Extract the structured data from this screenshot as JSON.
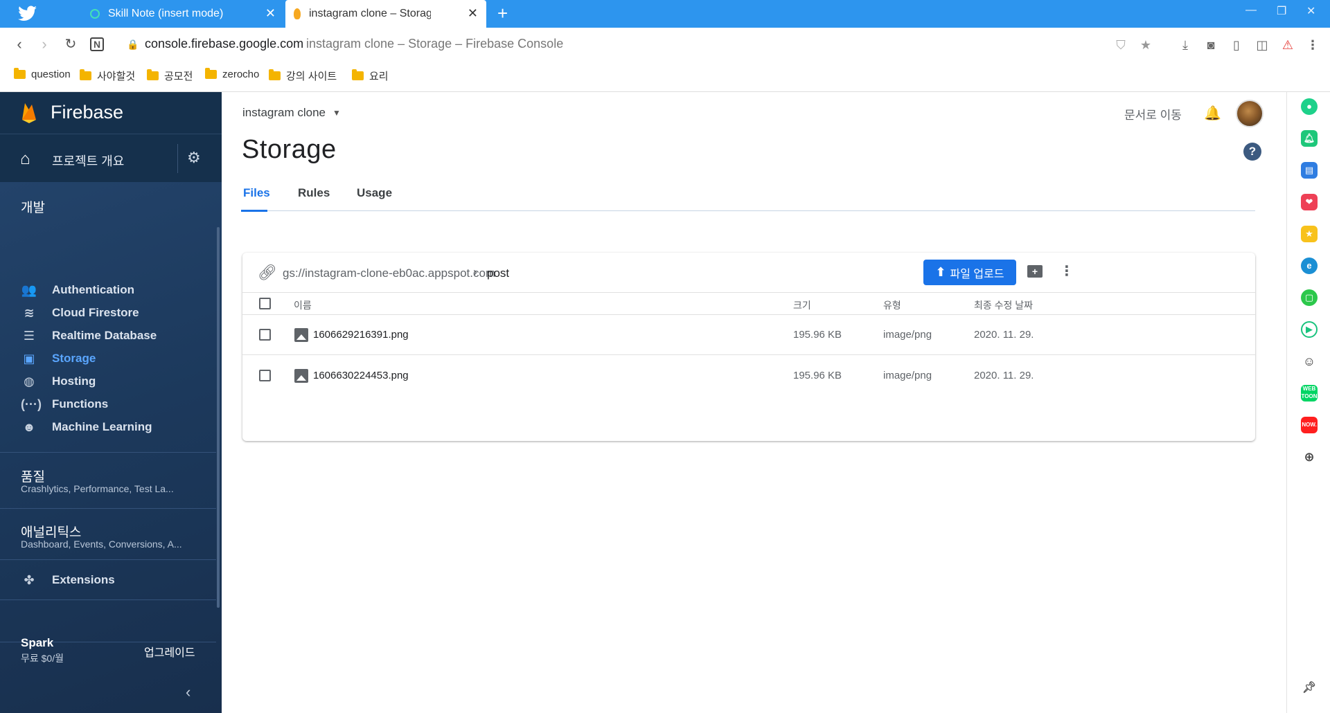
{
  "browser": {
    "tabs": [
      {
        "title": "Skill Note (insert mode)",
        "close": "✕"
      },
      {
        "title": "instagram clone – Storage – Fir",
        "close": "✕"
      }
    ],
    "new_tab": "+",
    "window_controls": {
      "minimize": "—",
      "restore": "❐",
      "close": "✕"
    },
    "address": {
      "host": "console.firebase.google.com",
      "page_title": "instagram clone – Storage – Firebase Console"
    },
    "bookmarks": [
      "question",
      "사야할것",
      "공모전",
      "zerocho",
      "강의 사이트",
      "요리"
    ]
  },
  "sidebar": {
    "brand": "Firebase",
    "overview_label": "프로젝트 개요",
    "develop_title": "개발",
    "develop_items": [
      {
        "label": "Authentication",
        "icon": "people-icon",
        "active": false
      },
      {
        "label": "Cloud Firestore",
        "icon": "firestore-icon",
        "active": false
      },
      {
        "label": "Realtime Database",
        "icon": "database-icon",
        "active": false
      },
      {
        "label": "Storage",
        "icon": "image-icon",
        "active": true
      },
      {
        "label": "Hosting",
        "icon": "globe-icon",
        "active": false
      },
      {
        "label": "Functions",
        "icon": "functions-icon",
        "active": false
      },
      {
        "label": "Machine Learning",
        "icon": "robot-icon",
        "active": false
      }
    ],
    "quality": {
      "title": "품질",
      "subtitle": "Crashlytics, Performance, Test La..."
    },
    "analytics": {
      "title": "애널리틱스",
      "subtitle": "Dashboard, Events, Conversions, A..."
    },
    "extensions": "Extensions",
    "plan": {
      "name": "Spark",
      "price": "무료 $0/월",
      "upgrade": "업그레이드"
    }
  },
  "main": {
    "project_name": "instagram clone",
    "docs_link": "문서로 이동",
    "title": "Storage",
    "tabs": [
      "Files",
      "Rules",
      "Usage"
    ],
    "bucket_path": "gs://instagram-clone-eb0ac.appspot.com",
    "breadcrumb_sep": "›",
    "current_folder": "post",
    "upload_label": "파일 업로드",
    "columns": {
      "name": "이름",
      "size": "크기",
      "type": "유형",
      "modified": "최종 수정 날짜"
    },
    "files": [
      {
        "name": "1606629216391.png",
        "size": "195.96 KB",
        "type": "image/png",
        "modified": "2020. 11. 29."
      },
      {
        "name": "1606630224453.png",
        "size": "195.96 KB",
        "type": "image/png",
        "modified": "2020. 11. 29."
      }
    ]
  },
  "colors": {
    "accent": "#1a73e8",
    "sidebar_bg": "#1f3a5a",
    "tabbar": "#2d95ee",
    "active_nav": "#5aa6ff"
  }
}
